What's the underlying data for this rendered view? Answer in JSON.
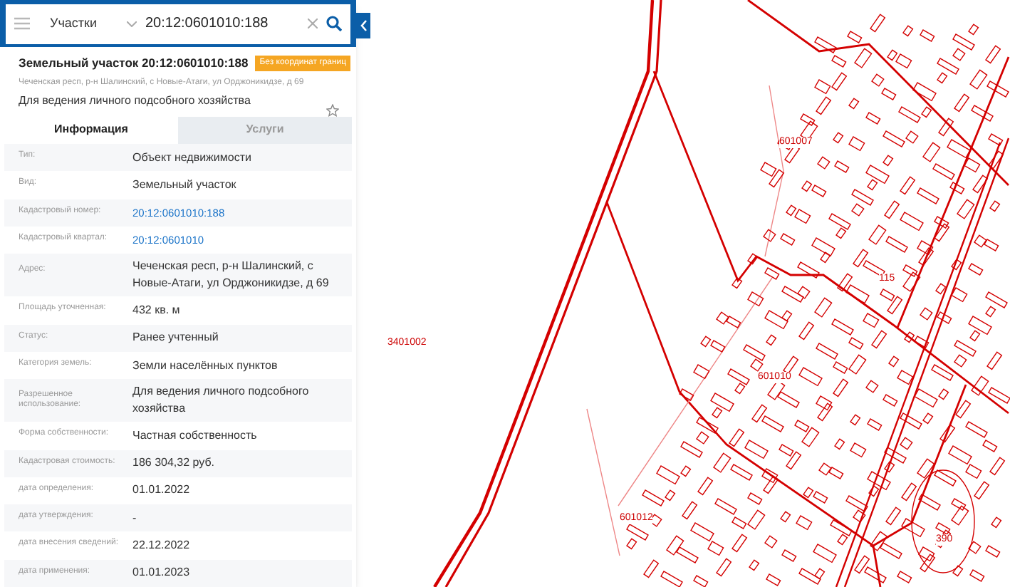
{
  "search": {
    "layer": "Участки",
    "query": "20:12:0601010:188"
  },
  "object": {
    "title": "Земельный участок 20:12:0601010:188",
    "badge": "Без координат границ",
    "address": "Чеченская респ, р-н Шалинский, с Новые-Атаги, ул Орджоникидзе, д 69",
    "purpose": "Для ведения личного подсобного хозяйства",
    "favorite": false
  },
  "tabs": [
    {
      "label": "Информация",
      "selected": true
    },
    {
      "label": "Услуги",
      "selected": false
    }
  ],
  "rows": [
    {
      "label": "Тип:",
      "value": "Объект недвижимости",
      "kind": "text"
    },
    {
      "label": "Вид:",
      "value": "Земельный участок",
      "kind": "text"
    },
    {
      "label": "Кадастровый номер:",
      "value": "20:12:0601010:188",
      "kind": "link"
    },
    {
      "label": "Кадастровый квартал:",
      "value": "20:12:0601010",
      "kind": "link"
    },
    {
      "label": "Адрес:",
      "value": "Чеченская респ, р-н Шалинский, с Новые-Атаги, ул Орджоникидзе, д 69",
      "kind": "text"
    },
    {
      "label": "Площадь уточненная:",
      "value": "432 кв. м",
      "kind": "text"
    },
    {
      "label": "Статус:",
      "value": "Ранее учтенный",
      "kind": "text"
    },
    {
      "label": "Категория земель:",
      "value": "Земли населённых пунктов",
      "kind": "text"
    },
    {
      "label": "Разрешенное использование:",
      "value": "Для ведения личного подсобного хозяйства",
      "kind": "text"
    },
    {
      "label": "Форма собственности:",
      "value": "Частная собственность",
      "kind": "text"
    },
    {
      "label": "Кадастровая стоимость:",
      "value": "186 304,32 руб.",
      "kind": "text"
    },
    {
      "label": "дата определения:",
      "value": "01.01.2022",
      "kind": "text"
    },
    {
      "label": "дата утверждения:",
      "value": "-",
      "kind": "text"
    },
    {
      "label": "дата внесения сведений:",
      "value": "22.12.2022",
      "kind": "text"
    },
    {
      "label": "дата применения:",
      "value": "01.01.2023",
      "kind": "text"
    }
  ],
  "map": {
    "labels": [
      "3401002",
      "601007",
      "601010",
      "601012",
      "115",
      "390"
    ]
  }
}
